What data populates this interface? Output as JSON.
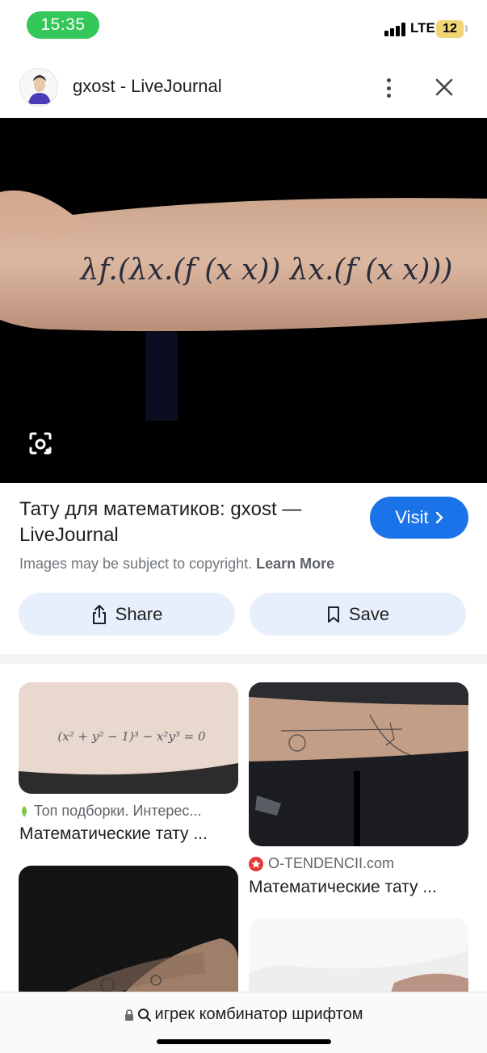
{
  "status_bar": {
    "time": "15:35",
    "network": "LTE",
    "battery": "12"
  },
  "header": {
    "site_title": "gxost - LiveJournal"
  },
  "main_image": {
    "tattoo_formula": "λf.(λx.(f (x x)) λx.(f (x x)))"
  },
  "result": {
    "title": "Тату для математиков: gxost — LiveJournal",
    "visit_label": "Visit",
    "copyright_text": "Images may be subject to copyright.",
    "learn_more": "Learn More",
    "share_label": "Share",
    "save_label": "Save"
  },
  "related": [
    {
      "source": "Топ подборки. Интерес...",
      "title": "Математические тату ...",
      "formula": "(x² + y² − 1)³ − x²y³ = 0"
    },
    {
      "source": "O-TENDENCII.com",
      "title": "Математические тату ..."
    }
  ],
  "bottom_bar": {
    "url": "игрек комбинатор шрифтом"
  },
  "colors": {
    "accent": "#1a73e8",
    "time_pill": "#34c759",
    "battery": "#f1d574",
    "action_bg": "#e8effc"
  }
}
